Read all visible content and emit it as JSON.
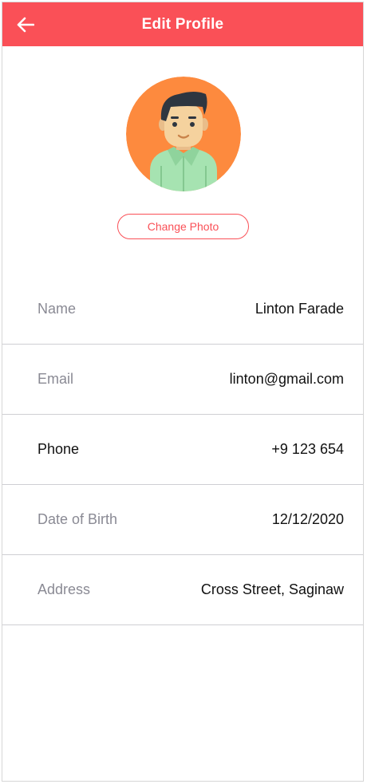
{
  "header": {
    "title": "Edit Profile",
    "back_icon": "arrow-left-icon",
    "background_color": "#fa5057"
  },
  "profile": {
    "avatar_icon": "male-avatar-icon",
    "change_photo_label": "Change Photo"
  },
  "fields": [
    {
      "label": "Name",
      "value": "Linton Farade"
    },
    {
      "label": "Email",
      "value": "linton@gmail.com"
    },
    {
      "label": "Phone",
      "value": "+9 123 654"
    },
    {
      "label": "Date of Birth",
      "value": "12/12/2020"
    },
    {
      "label": "Address",
      "value": "Cross Street, Saginaw"
    }
  ]
}
